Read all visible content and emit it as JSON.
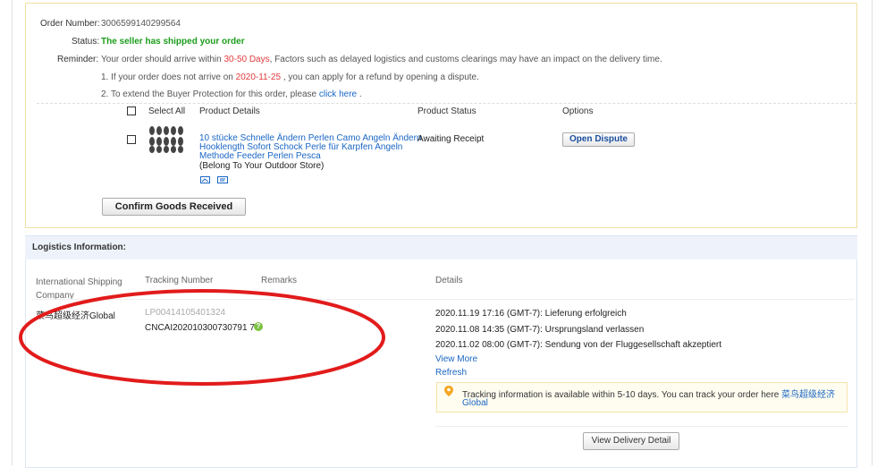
{
  "order": {
    "order_number_label": "Order Number:",
    "order_number": "3006599140299564",
    "status_label": "Status:",
    "status": "The seller has shipped your order",
    "reminder_label": "Reminder:",
    "reminder_pre": "Your order should arrive within ",
    "reminder_days": "30-50 Days",
    "reminder_post": ", Factors such as delayed logistics and customs clearings may have an impact on the delivery time.",
    "note1_pre": "1. If your order does not arrive on ",
    "note1_date": "2020-11-25",
    "note1_post": " , you can apply for a refund by opening a dispute.",
    "note2_pre": "2. To extend the Buyer Protection for this order, please ",
    "note2_link": "click here",
    "note2_post": " ."
  },
  "products": {
    "headers": {
      "select_all": "Select All",
      "details": "Product Details",
      "status": "Product Status",
      "options": "Options"
    },
    "item": {
      "title_line1": "10 stücke Schnelle Ändern Perlen Camo Angeln Ändern",
      "title_line2": "Hooklength Sofort Schock Perle für Karpfen Angeln",
      "title_line3": "Methode Feeder Perlen Pesca",
      "store": "(Belong To Your Outdoor Store)",
      "status": "Awaiting Receipt",
      "open_dispute": "Open Dispute"
    },
    "confirm_button": "Confirm Goods Received"
  },
  "logistics": {
    "title": "Logistics Information:",
    "headers": {
      "company_line1": "International Shipping",
      "company_line2": "Company",
      "tracking": "Tracking Number",
      "remarks": "Remarks",
      "details": "Details"
    },
    "company": "菜鸟超级经济Global",
    "tracking_old": "LP00414105401324",
    "tracking": "CNCAI202010300730791 7",
    "events": [
      "2020.11.19 17:16 (GMT-7): Lieferung erfolgreich",
      "2020.11.08 14:35 (GMT-7): Ursprungsland verlassen",
      "2020.11.02 08:00 (GMT-7): Sendung von der Fluggesellschaft akzeptiert"
    ],
    "view_more": "View More",
    "refresh": "Refresh",
    "notice_text": "Tracking information is available within 5-10 days. You can track your order here ",
    "notice_link_line1": "菜鸟超级经济",
    "notice_link_line2": "Global",
    "view_delivery": "View Delivery Detail"
  },
  "colors": {
    "accent_link": "#1a66c4",
    "status_green": "#1b9d1b",
    "highlight_red": "#e4393c",
    "annotation_ellipse": "#e21b1b"
  }
}
